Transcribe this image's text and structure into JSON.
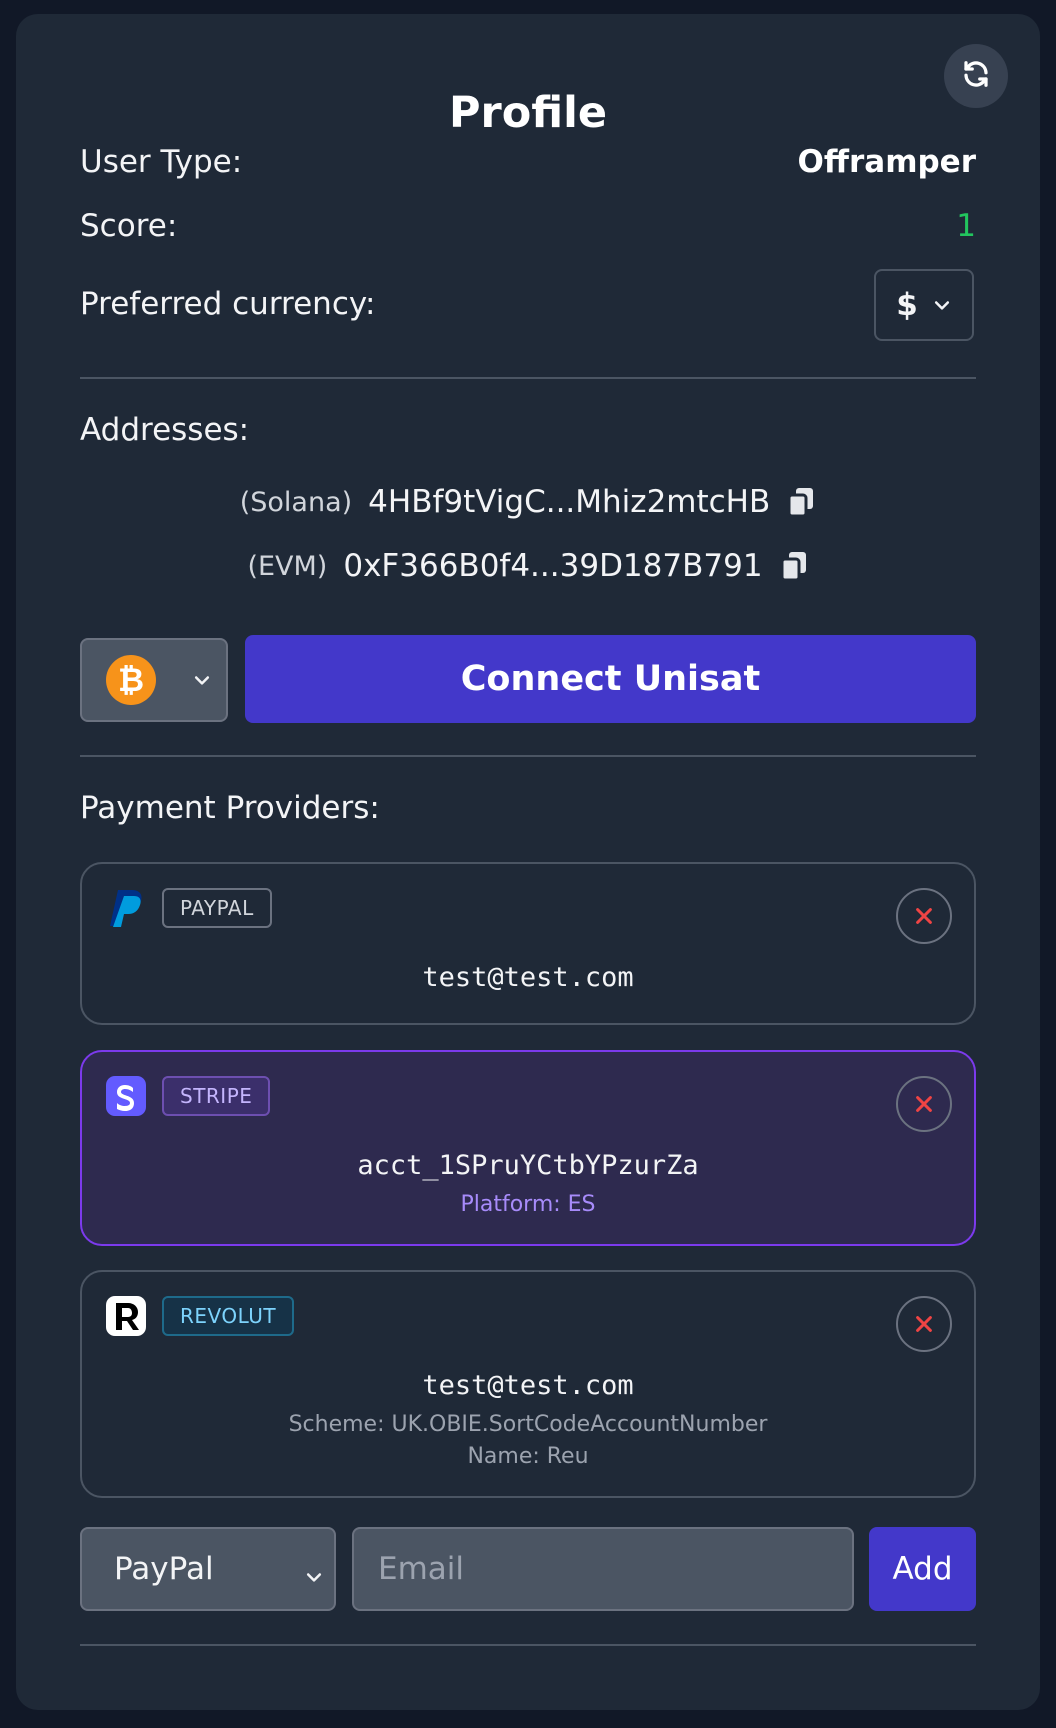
{
  "profile": {
    "title": "Profile",
    "user_type_label": "User Type:",
    "user_type_value": "Offramper",
    "score_label": "Score:",
    "score_value": "1",
    "currency_label": "Preferred currency:",
    "currency_value": "$"
  },
  "addresses": {
    "label": "Addresses:",
    "items": [
      {
        "chain": "(Solana)",
        "address": "4HBf9tVigC...Mhiz2mtcHB"
      },
      {
        "chain": "(EVM)",
        "address": "0xF366B0f4...39D187B791"
      }
    ]
  },
  "wallet": {
    "coin_icon": "bitcoin-icon",
    "connect_label": "Connect Unisat"
  },
  "providers": {
    "label": "Payment Providers:",
    "items": [
      {
        "badge": "PAYPAL",
        "icon": "paypal-logo",
        "main": "test@test.com"
      },
      {
        "badge": "STRIPE",
        "icon": "stripe-logo",
        "main": "acct_1SPruYCtbYPzurZa",
        "sub": "Platform: ES"
      },
      {
        "badge": "REVOLUT",
        "icon": "revolut-logo",
        "main": "test@test.com",
        "sub": "Scheme: UK.OBIE.SortCodeAccountNumber",
        "sub2": "Name: Reu"
      }
    ]
  },
  "add_form": {
    "provider_selected": "PayPal",
    "email_placeholder": "Email",
    "add_label": "Add"
  },
  "colors": {
    "accent": "#4338ca",
    "score_green": "#22c55e",
    "remove_red": "#ef4444",
    "bitcoin_orange": "#f7931a"
  }
}
